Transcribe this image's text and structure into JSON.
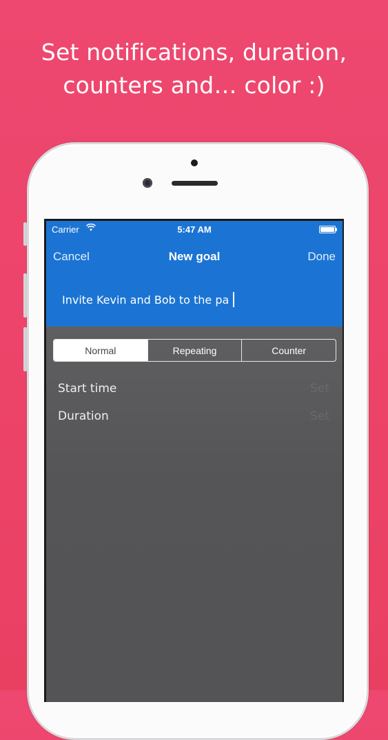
{
  "headline": {
    "line1": "Set notifications, duration,",
    "line2": "counters and… color :)"
  },
  "status_bar": {
    "carrier": "Carrier",
    "time": "5:47 AM"
  },
  "nav": {
    "cancel_label": "Cancel",
    "title": "New goal",
    "done_label": "Done"
  },
  "goal_input": {
    "value": "Invite Kevin and Bob to the pa"
  },
  "segments": [
    {
      "label": "Normal",
      "selected": true
    },
    {
      "label": "Repeating",
      "selected": false
    },
    {
      "label": "Counter",
      "selected": false
    }
  ],
  "settings": [
    {
      "label": "Start time",
      "action": "Set"
    },
    {
      "label": "Duration",
      "action": "Set"
    }
  ],
  "colors": {
    "background": "#ec4369",
    "nav_blue": "#1b74d4",
    "content_gray": "#555557"
  }
}
